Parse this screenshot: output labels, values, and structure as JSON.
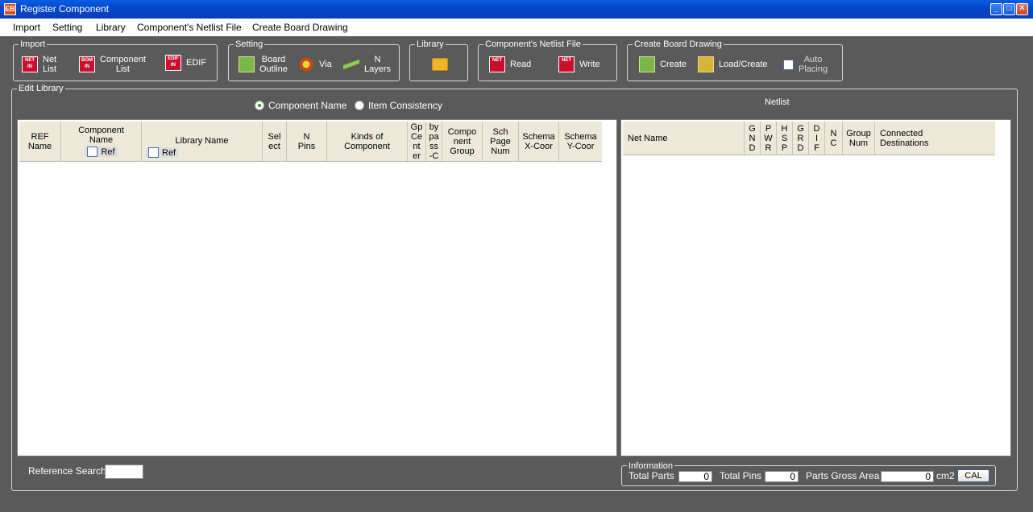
{
  "window": {
    "title": "Register Component",
    "app_icon": "register-component-app-icon",
    "controls": [
      "_",
      "□",
      "✕"
    ]
  },
  "menu": [
    "Import",
    "Setting",
    "Library",
    "Component's Netlist File",
    "Create Board Drawing"
  ],
  "toolbar": {
    "import": {
      "label": "Import",
      "net_list": {
        "icon": "NET IN",
        "l1": "Net",
        "l2": "List"
      },
      "component_list": {
        "icon": "BOM IN",
        "l1": "Component",
        "l2": "List"
      },
      "edif": {
        "icon": "EDIF IN",
        "l1": "EDIF"
      }
    },
    "setting": {
      "label": "Setting",
      "board_outline": {
        "l1": "Board",
        "l2": "Outline"
      },
      "via": {
        "l1": "Via"
      },
      "n_layers": {
        "l1": "N",
        "l2": "Layers"
      }
    },
    "library": {
      "label": "Library"
    },
    "netlist_file": {
      "label": "Component's Netlist File",
      "read": {
        "icon": "NET",
        "l1": "Read"
      },
      "write": {
        "icon": "NET",
        "l1": "Write"
      }
    },
    "board": {
      "label": "Create Board Drawing",
      "create": "Create",
      "load_create": "Load/Create",
      "auto_placing_l1": "Auto",
      "auto_placing_l2": "Placing"
    }
  },
  "edit_library": {
    "label": "Edit Library",
    "radio_component_name": "Component Name",
    "radio_item_consistency": "Item Consistency",
    "selected_radio": "component_name",
    "columns": {
      "ref_name": [
        "REF",
        "Name"
      ],
      "component_name": [
        "Component",
        "Name"
      ],
      "component_ref": "Ref",
      "library_name": "Library Name",
      "library_ref": "Ref",
      "select": [
        "Sel",
        "ect"
      ],
      "n_pins": [
        "N",
        "Pins"
      ],
      "kinds": [
        "Kinds of",
        "Component"
      ],
      "gp_center": [
        "Gp",
        "Ce",
        "nt",
        "er"
      ],
      "bypass": [
        "by",
        "pa",
        "ss",
        "-C"
      ],
      "comp_group": [
        "Compo",
        "nent",
        "Group"
      ],
      "sch_page": [
        "Sch",
        "Page",
        "Num"
      ],
      "schema_x": [
        "Schema",
        "X-Coor"
      ],
      "schema_y": [
        "Schema",
        "Y-Coor"
      ]
    }
  },
  "netlist": {
    "title": "Netlist",
    "columns": {
      "net_name": "Net Name",
      "gnd": [
        "G",
        "N",
        "D"
      ],
      "pwr": [
        "P",
        "W",
        "R"
      ],
      "hsp": [
        "H",
        "S",
        "P"
      ],
      "grd": [
        "G",
        "R",
        "D"
      ],
      "dif": [
        "D",
        "I",
        "F"
      ],
      "nc": [
        "N",
        "C"
      ],
      "group_num": [
        "Group",
        "Num"
      ],
      "connected": [
        "Connected",
        "Destinations"
      ]
    }
  },
  "reference_search": {
    "label": "Reference Search",
    "value": ""
  },
  "information": {
    "label": "Information",
    "total_parts_label": "Total Parts",
    "total_parts": "0",
    "total_pins_label": "Total Pins",
    "total_pins": "0",
    "gross_area_label": "Parts Gross Area",
    "gross_area": "0",
    "unit": "cm2",
    "cal": "CAL"
  }
}
